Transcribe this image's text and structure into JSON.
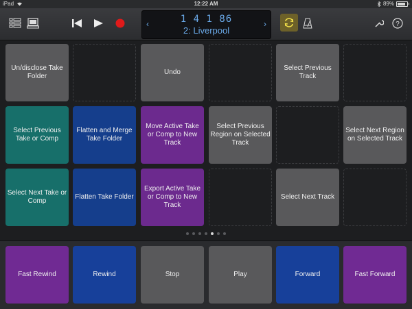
{
  "status": {
    "device": "iPad",
    "time": "12:22 AM",
    "battery": "89%"
  },
  "lcd": {
    "position": "1  4  1    86",
    "track": "2: Liverpool"
  },
  "colors": {
    "gray": "#59595b",
    "teal": "#176f6a",
    "blue": "#153e8c",
    "purple": "#6c2a8e",
    "record": "#e01a1a",
    "cycle": "#6d6129"
  },
  "grid": {
    "r1c1": "Un/disclose Take Folder",
    "r1c3": "Undo",
    "r1c5": "Select Previous Track",
    "r2c1": "Select Previous Take or Comp",
    "r2c2": "Flatten and Merge Take Folder",
    "r2c3": "Move Active Take or Comp to New Track",
    "r2c4": "Select Previous Region on Selected Track",
    "r2c6": "Select Next Region on Selected Track",
    "r3c1": "Select Next Take or Comp",
    "r3c2": "Flatten Take Folder",
    "r3c3": "Export Active Take or Comp to New Track",
    "r3c5": "Select Next Track"
  },
  "page_indicator": {
    "count": 7,
    "active": 5
  },
  "transport": {
    "fast_rewind": "Fast Rewind",
    "rewind": "Rewind",
    "stop": "Stop",
    "play": "Play",
    "forward": "Forward",
    "fast_forward": "Fast Forward"
  }
}
